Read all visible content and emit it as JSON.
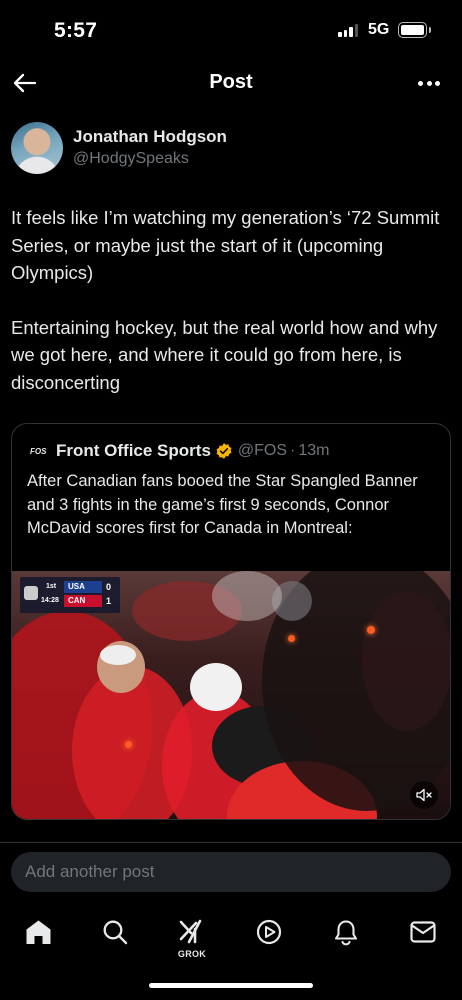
{
  "status_bar": {
    "time": "5:57",
    "network": "5G"
  },
  "header": {
    "title": "Post"
  },
  "author": {
    "name": "Jonathan Hodgson",
    "handle": "@HodgySpeaks"
  },
  "post": {
    "paragraphs": [
      "It feels like I’m watching my generation’s ‘72 Summit Series, or maybe just the start of it (upcoming Olympics)",
      "Entertaining hockey, but the real world how and why we got here, and where it could go from here, is disconcerting"
    ]
  },
  "quote": {
    "logo_text": "FOS",
    "name": "Front Office Sports",
    "handle": "@FOS",
    "separator": "·",
    "time": "13m",
    "text": "After Canadian fans booed the Star Spangled Banner and 3 fights in the game’s first 9 seconds, Connor McDavid scores first for Canada in Montreal:",
    "video": {
      "scorebug": {
        "period": "1st",
        "clock": "14:28",
        "team1": "USA",
        "score1": "0",
        "team2": "CAN",
        "score2": "1"
      }
    }
  },
  "reply": {
    "placeholder": "Add another post"
  },
  "tabbar": {
    "tabs": [
      "home-icon",
      "search-icon",
      "grok-icon",
      "video-icon",
      "notifications-icon",
      "messages-icon"
    ],
    "grok_label": "GROK"
  },
  "colors": {
    "background": "#000000",
    "text": "#e7e9ea",
    "muted": "#71767b",
    "verified": "#f4b400",
    "border": "#2f3336"
  }
}
